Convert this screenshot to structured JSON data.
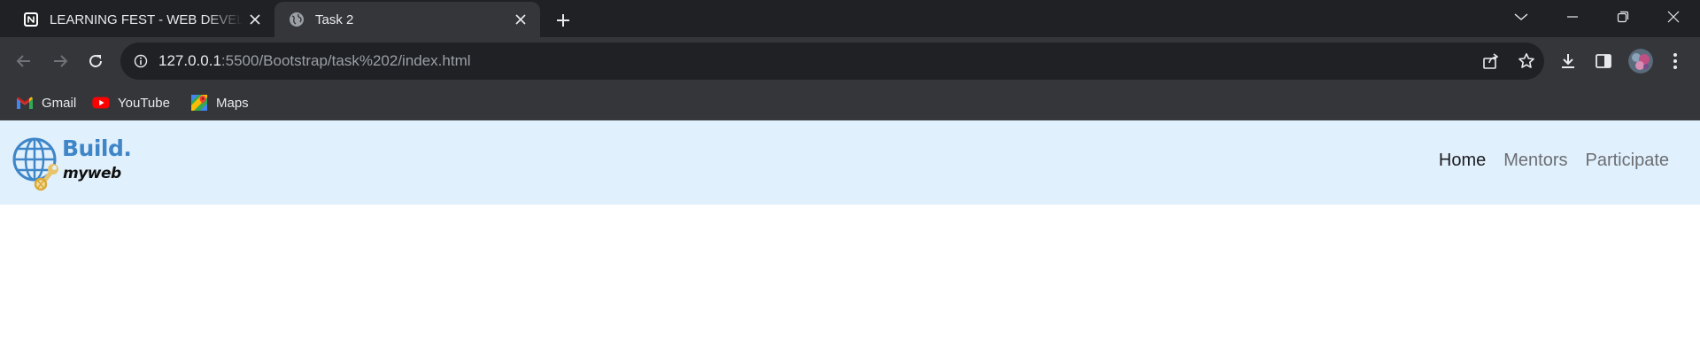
{
  "browser": {
    "tabs": [
      {
        "title": "LEARNING FEST - WEB DEVELOPMENT",
        "favicon": "notion-icon",
        "active": false
      },
      {
        "title": "Task 2",
        "favicon": "globe-icon",
        "active": true
      }
    ],
    "address": {
      "host": "127.0.0.1",
      "path": ":5500/Bootstrap/task%202/index.html"
    },
    "bookmarks": [
      {
        "label": "Gmail",
        "icon": "gmail-icon"
      },
      {
        "label": "YouTube",
        "icon": "youtube-icon"
      },
      {
        "label": "Maps",
        "icon": "maps-icon"
      }
    ]
  },
  "site": {
    "brand": {
      "line1": "Build.",
      "line2": "myweb"
    },
    "nav": [
      {
        "label": "Home",
        "active": true
      },
      {
        "label": "Mentors",
        "active": false
      },
      {
        "label": "Participate",
        "active": false
      }
    ]
  },
  "colors": {
    "tabstrip": "#202124",
    "toolbar": "#35363a",
    "navbar": "#e1f0fd",
    "brand_blue": "#3f86c8",
    "nav_active": "#1c1d1f",
    "nav_inactive": "#6b6e72"
  }
}
